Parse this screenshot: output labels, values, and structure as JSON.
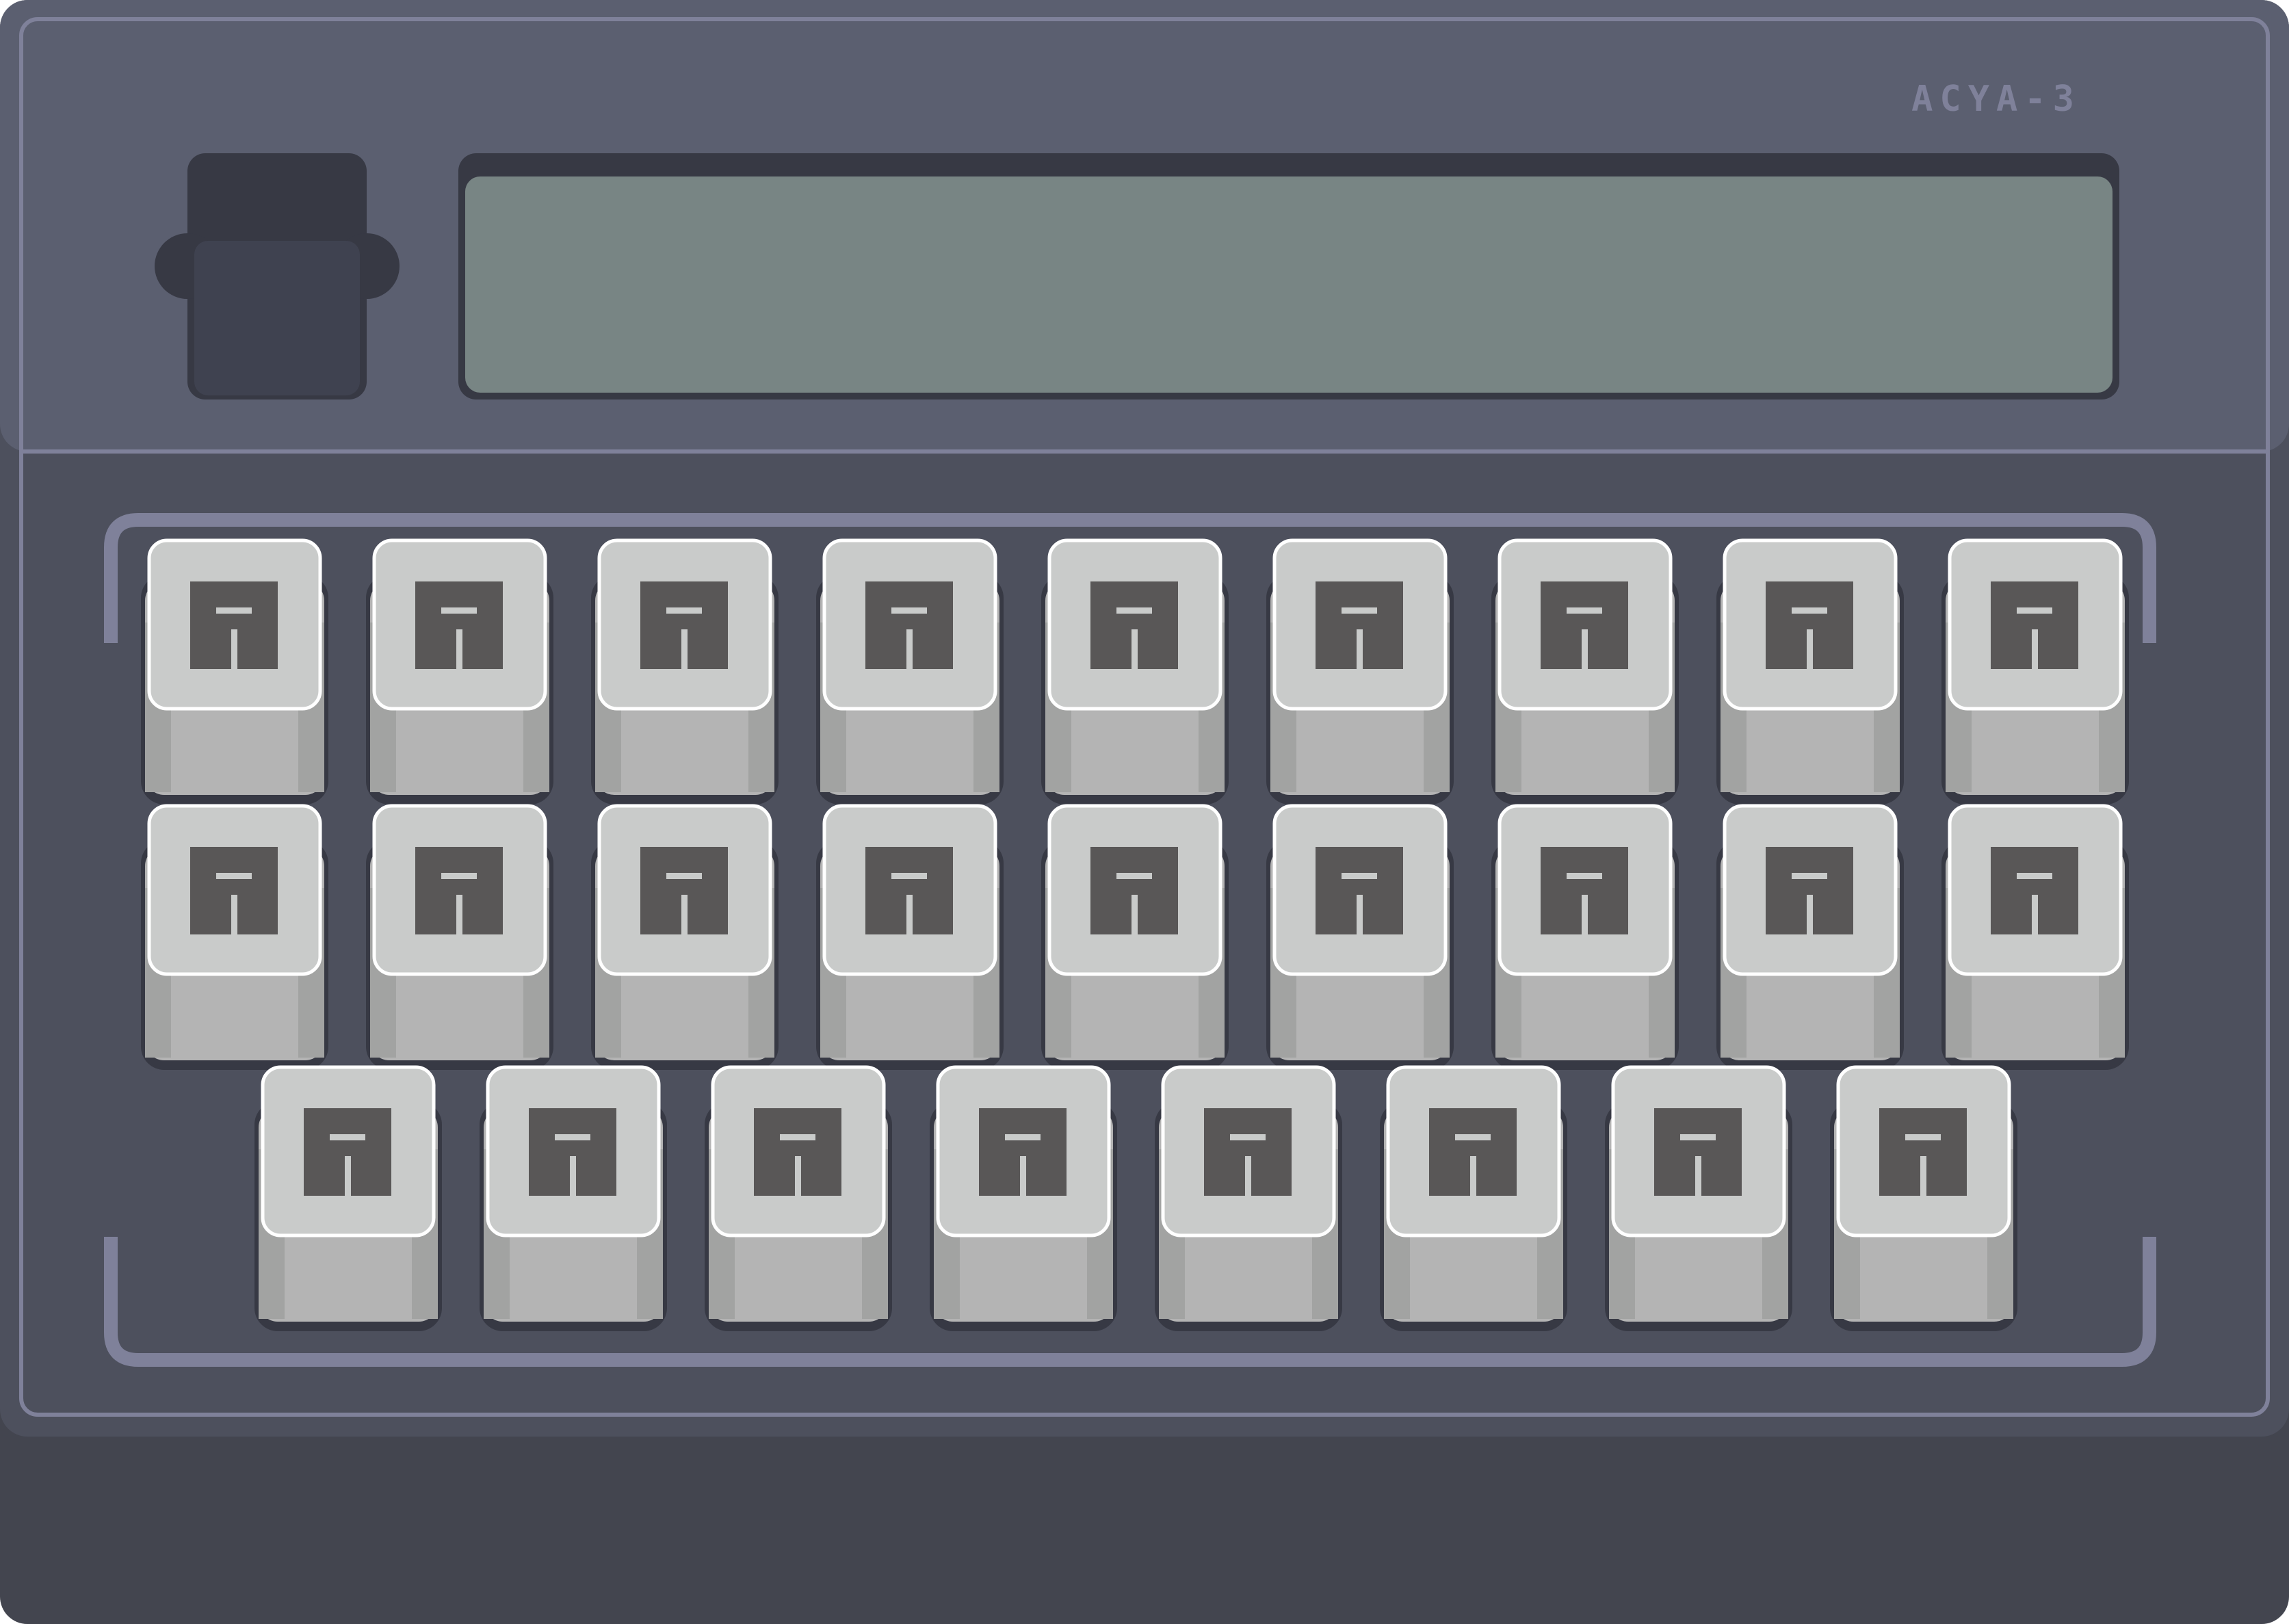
{
  "device": {
    "brand_logo_text": "ACYA-3",
    "colors": {
      "body_top": "#5b5f70",
      "body_bottom": "#4c4f5c",
      "base": "#43454f",
      "trim": "#7f819a",
      "screen": "#788584",
      "screen_bezel": "#373944",
      "key_cap": "#c9cbca",
      "key_side": "#b4b4b4",
      "key_glyph": "#595757"
    },
    "cartridge_slot": {
      "icon": "cartridge-slot"
    },
    "display": {
      "text": ""
    },
    "keyboard": {
      "key_glyph_icon": "alien-glyph-icon",
      "rows": [
        {
          "key_count": 9
        },
        {
          "key_count": 9
        },
        {
          "key_count": 8
        }
      ]
    }
  }
}
